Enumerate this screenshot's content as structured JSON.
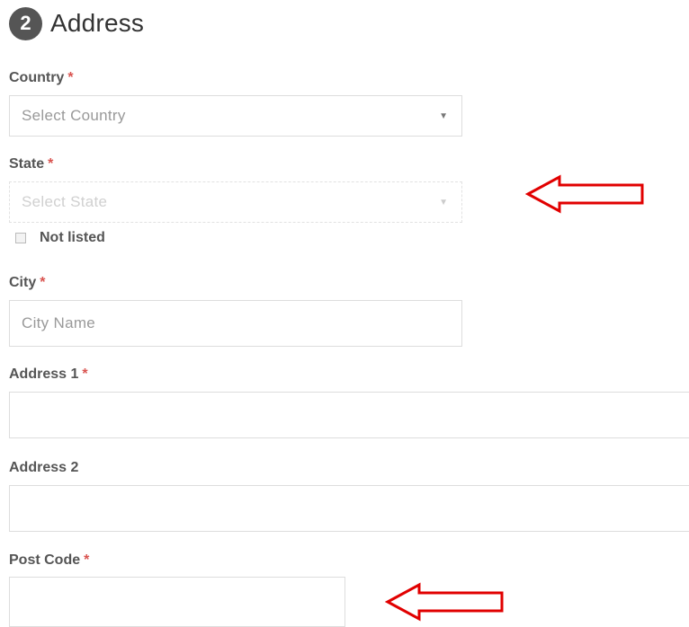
{
  "section": {
    "step": "2",
    "title": "Address"
  },
  "required_marker": "*",
  "fields": {
    "country": {
      "label": "Country",
      "placeholder": "Select Country"
    },
    "state": {
      "label": "State",
      "placeholder": "Select State",
      "disabled": true
    },
    "not_listed": {
      "label": "Not listed",
      "checked": false
    },
    "city": {
      "label": "City",
      "placeholder": "City Name",
      "value": ""
    },
    "address1": {
      "label": "Address 1",
      "value": ""
    },
    "address2": {
      "label": "Address 2",
      "value": ""
    },
    "post_code": {
      "label": "Post Code",
      "value": ""
    }
  },
  "icons": {
    "dropdown": "caret-down-icon",
    "annotation": "left-arrow-icon"
  },
  "colors": {
    "required": "#d9534f",
    "annotation_arrow": "#e10000",
    "badge": "#555555"
  }
}
